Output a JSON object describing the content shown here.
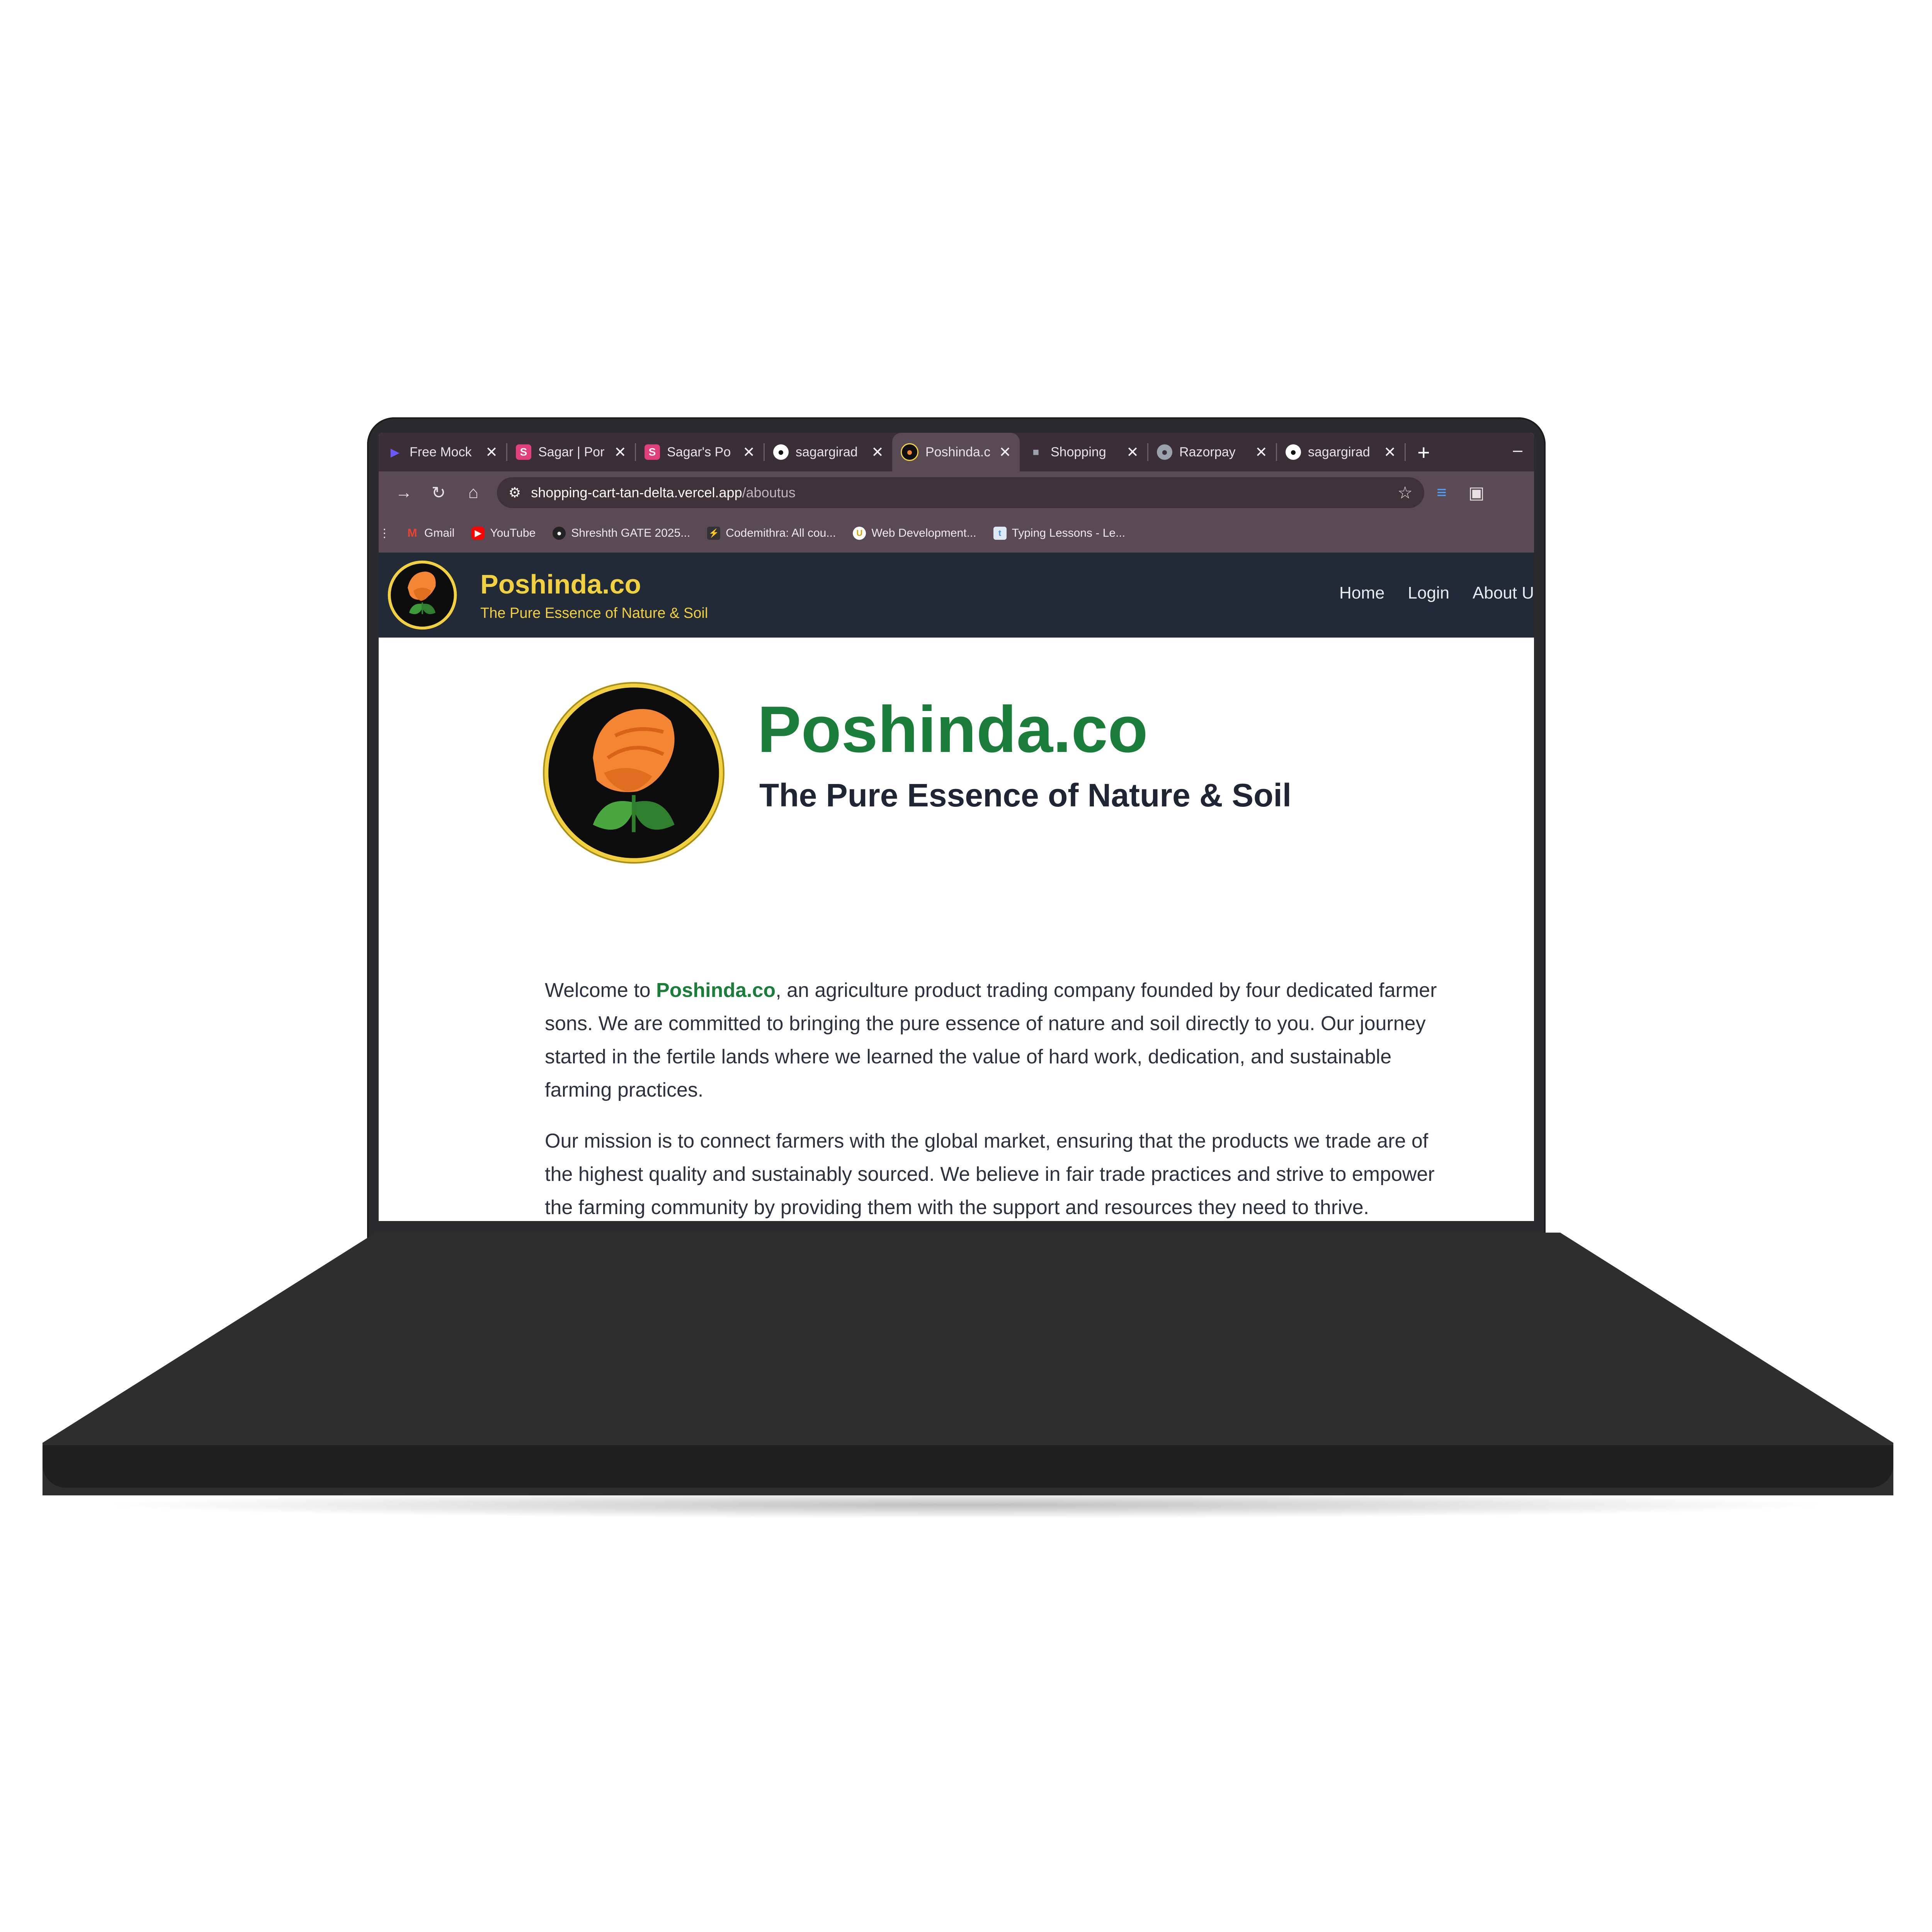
{
  "browser": {
    "tabs": [
      {
        "label": "Free Mock",
        "icon": "arrow-play-icon",
        "color": "#6a5af9"
      },
      {
        "label": "Sagar | Por",
        "icon": "s-logo-icon",
        "color": "#e0407b"
      },
      {
        "label": "Sagar's Po",
        "icon": "s-logo-icon",
        "color": "#e0407b"
      },
      {
        "label": "sagargirad",
        "icon": "github-icon",
        "color": "#ffffff"
      },
      {
        "label": "Poshinda.c",
        "icon": "poshinda-logo-icon",
        "color": "#f48533",
        "active": true
      },
      {
        "label": "Shopping",
        "icon": "cart-icon",
        "color": "#9aa3ad"
      },
      {
        "label": "Razorpay",
        "icon": "globe-icon",
        "color": "#9aa3ad"
      },
      {
        "label": "sagargirad",
        "icon": "github-icon",
        "color": "#ffffff"
      }
    ],
    "new_tab": "+",
    "minimize": "–",
    "address": {
      "domain": "shopping-cart-tan-delta.vercel.app",
      "path": "/aboutus"
    },
    "bookmarks": [
      {
        "label": "Gmail",
        "icon": "gmail-icon",
        "color": "#ea4335"
      },
      {
        "label": "YouTube",
        "icon": "youtube-icon",
        "color": "#ff0000"
      },
      {
        "label": "Shreshth GATE 2025...",
        "icon": "globe-icon",
        "color": "#555555"
      },
      {
        "label": "Codemithra: All cou...",
        "icon": "lightning-icon",
        "color": "#333333"
      },
      {
        "label": "Web Development...",
        "icon": "udemy-icon",
        "color": "#d9a400"
      },
      {
        "label": "Typing Lessons - Le...",
        "icon": "typing-icon",
        "color": "#4a90e2"
      }
    ]
  },
  "site": {
    "brand": "Poshinda.co",
    "tagline": "The Pure Essence of Nature & Soil",
    "nav": [
      "Home",
      "Login",
      "About U"
    ],
    "colors": {
      "header_bg": "#222a37",
      "accent_yellow": "#f1d13f",
      "brand_green": "#1a7d3a",
      "turban_orange": "#f48533"
    }
  },
  "about": {
    "title": "Poshinda.co",
    "subtitle": "The Pure Essence of Nature & Soil",
    "p1_prefix": "Welcome to ",
    "p1_brand": "Poshinda.co",
    "p1_rest": ", an agriculture product trading company founded by four dedicated farmer sons. We are committed to bringing the pure essence of nature and soil directly to you. Our journey started in the fertile lands where we learned the value of hard work, dedication, and sustainable farming practices.",
    "p2": "Our mission is to connect farmers with the global market, ensuring that the products we trade are of the highest quality and sustainably sourced. We believe in fair trade practices and strive to empower the farming community by providing them with the support and resources they need to thrive."
  }
}
